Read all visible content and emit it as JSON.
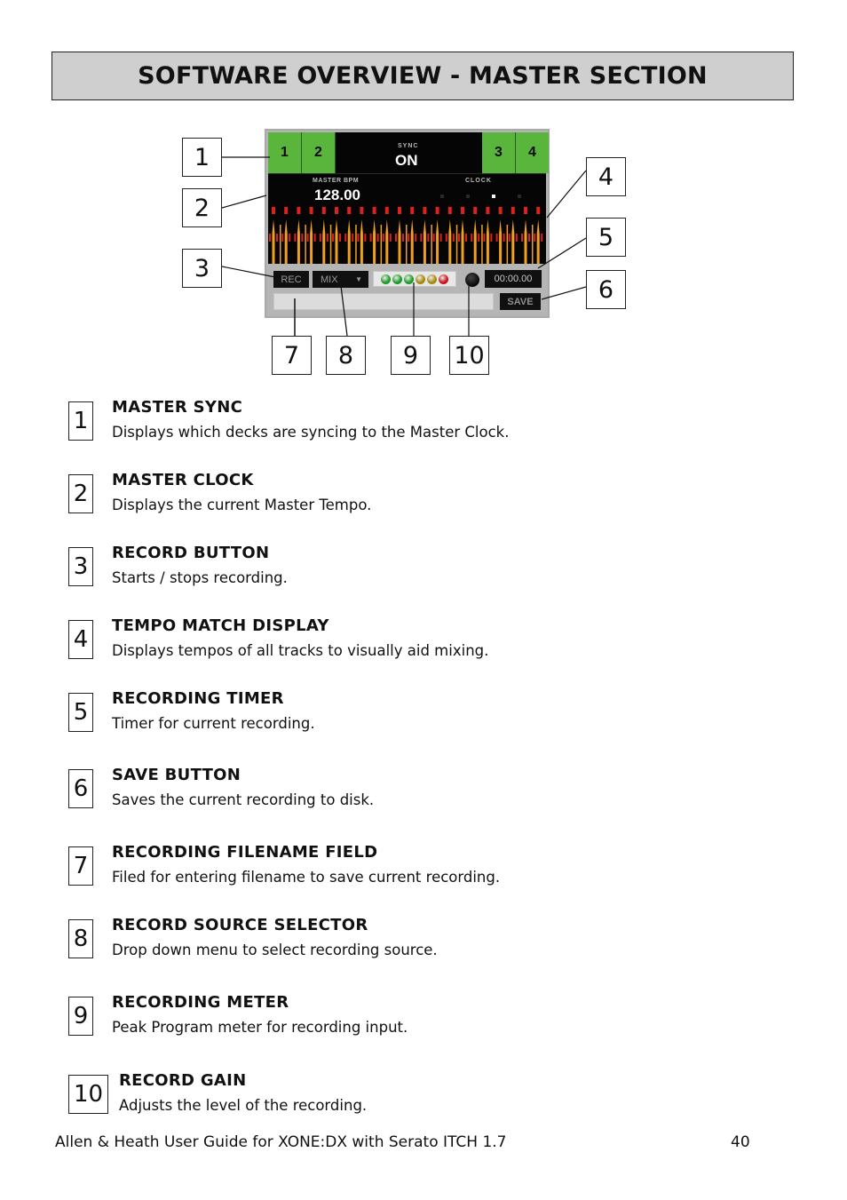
{
  "page": {
    "title": "SOFTWARE OVERVIEW - MASTER SECTION",
    "footer_text": "Allen & Heath User Guide for XONE:DX with Serato ITCH 1.7",
    "page_number": "40"
  },
  "screenshot": {
    "decks": [
      "1",
      "2",
      "3",
      "4"
    ],
    "sync_label": "SYNC",
    "sync_value": "ON",
    "bpm_label": "MASTER BPM",
    "bpm_value": "128.00",
    "clock_label": "CLOCK",
    "clock_beats": 4,
    "clock_active_beat": 3,
    "rec_label": "REC",
    "source_value": "MIX",
    "source_arrow": "▼",
    "meter_leds": [
      "#1f9a2a",
      "#1f9a2a",
      "#1f9a2a",
      "#a58a10",
      "#a58a10",
      "#c8141a"
    ],
    "timer_value": "00:00.00",
    "filename_value": "",
    "save_label": "SAVE",
    "colors": {
      "deck_green": "#5ab53c",
      "wave_orange": "#f0a020",
      "wave_red": "#e0201a",
      "panel_grey": "#b5b5b5"
    }
  },
  "callouts": [
    "1",
    "2",
    "3",
    "4",
    "5",
    "6",
    "7",
    "8",
    "9",
    "10"
  ],
  "items": [
    {
      "num": "1",
      "title": "MASTER SYNC",
      "desc": "Displays which decks are syncing to the Master Clock."
    },
    {
      "num": "2",
      "title": "MASTER CLOCK",
      "desc": "Displays the current Master Tempo."
    },
    {
      "num": "3",
      "title": "RECORD BUTTON",
      "desc": "Starts / stops recording."
    },
    {
      "num": "4",
      "title": "TEMPO MATCH DISPLAY",
      "desc": "Displays tempos of all tracks to visually aid mixing."
    },
    {
      "num": "5",
      "title": "RECORDING TIMER",
      "desc": "Timer for current recording."
    },
    {
      "num": "6",
      "title": "SAVE BUTTON",
      "desc": "Saves the current recording to disk."
    },
    {
      "num": "7",
      "title": "RECORDING FILENAME FIELD",
      "desc": "Filed for entering filename to save current recording."
    },
    {
      "num": "8",
      "title": "RECORD SOURCE SELECTOR",
      "desc": "Drop down menu to select recording source."
    },
    {
      "num": "9",
      "title": "RECORDING METER",
      "desc": "Peak Program meter for recording input."
    },
    {
      "num": "10",
      "title": "RECORD GAIN",
      "desc": "Adjusts the level of the recording."
    }
  ]
}
